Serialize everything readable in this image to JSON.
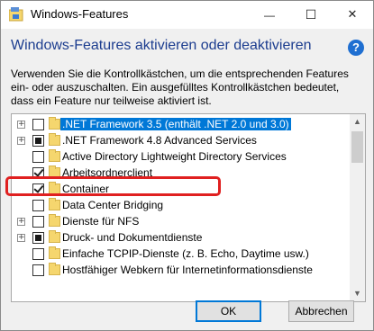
{
  "window": {
    "title": "Windows-Features",
    "minimize_glyph": "—",
    "maximize_glyph": "☐",
    "close_glyph": "✕"
  },
  "heading": "Windows-Features aktivieren oder deaktivieren",
  "help_glyph": "?",
  "description": "Verwenden Sie die Kontrollkästchen, um die entsprechenden Features ein- oder auszuschalten. Ein ausgefülltes Kontrollkästchen bedeutet, dass ein Feature nur teilweise aktiviert ist.",
  "features": [
    {
      "label": ".NET Framework 3.5 (enthält .NET 2.0 und 3.0)",
      "expandable": true,
      "state": "unchecked",
      "selected": true
    },
    {
      "label": ".NET Framework 4.8 Advanced Services",
      "expandable": true,
      "state": "partial",
      "selected": false
    },
    {
      "label": "Active Directory Lightweight Directory Services",
      "expandable": false,
      "state": "unchecked",
      "selected": false
    },
    {
      "label": "Arbeitsordnerclient",
      "expandable": false,
      "state": "checked",
      "selected": false
    },
    {
      "label": "Container",
      "expandable": false,
      "state": "checked",
      "selected": false
    },
    {
      "label": "Data Center Bridging",
      "expandable": false,
      "state": "unchecked",
      "selected": false
    },
    {
      "label": "Dienste für NFS",
      "expandable": true,
      "state": "unchecked",
      "selected": false
    },
    {
      "label": "Druck- und Dokumentdienste",
      "expandable": true,
      "state": "partial",
      "selected": false
    },
    {
      "label": "Einfache TCPIP-Dienste (z. B. Echo, Daytime usw.)",
      "expandable": false,
      "state": "unchecked",
      "selected": false
    },
    {
      "label": "Hostfähiger Webkern für Internetinformationsdienste",
      "expandable": false,
      "state": "unchecked",
      "selected": false
    }
  ],
  "expand_glyph": "+",
  "scroll_up_glyph": "▲",
  "scroll_down_glyph": "▼",
  "buttons": {
    "ok": "OK",
    "cancel": "Abbrechen"
  },
  "colors": {
    "selection": "#0078d7",
    "annotation_highlight": "#e02020",
    "heading": "#1c3d8f"
  }
}
